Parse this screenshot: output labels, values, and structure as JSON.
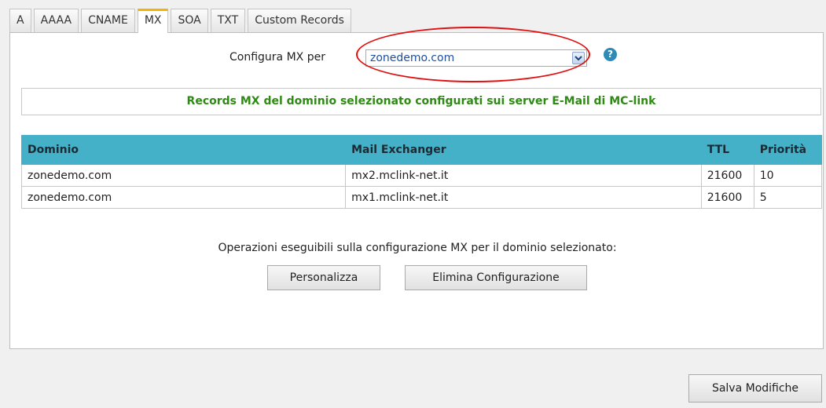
{
  "tabs": [
    {
      "label": "A"
    },
    {
      "label": "AAAA"
    },
    {
      "label": "CNAME"
    },
    {
      "label": "MX"
    },
    {
      "label": "SOA"
    },
    {
      "label": "TXT"
    },
    {
      "label": "Custom Records"
    }
  ],
  "active_tab": "MX",
  "config": {
    "label": "Configura MX per",
    "selected_domain": "zonedemo.com",
    "help_glyph": "?"
  },
  "notice": "Records MX del dominio selezionato configurati sui server E-Mail di MC-link",
  "table": {
    "headers": {
      "domain": "Dominio",
      "exchanger": "Mail Exchanger",
      "ttl": "TTL",
      "priority": "Priorità"
    },
    "rows": [
      {
        "domain": "zonedemo.com",
        "exchanger": "mx2.mclink-net.it",
        "ttl": "21600",
        "priority": "10"
      },
      {
        "domain": "zonedemo.com",
        "exchanger": "mx1.mclink-net.it",
        "ttl": "21600",
        "priority": "5"
      }
    ]
  },
  "operations": {
    "label": "Operazioni eseguibili sulla configurazione MX per il dominio selezionato:",
    "customize_label": "Personalizza",
    "delete_label": "Elimina Configurazione"
  },
  "save_label": "Salva Modifiche",
  "colors": {
    "table_header": "#45b1c9",
    "notice_text": "#2e8a14",
    "active_tab_accent": "#f2b400",
    "annotation_oval": "#e01010"
  }
}
